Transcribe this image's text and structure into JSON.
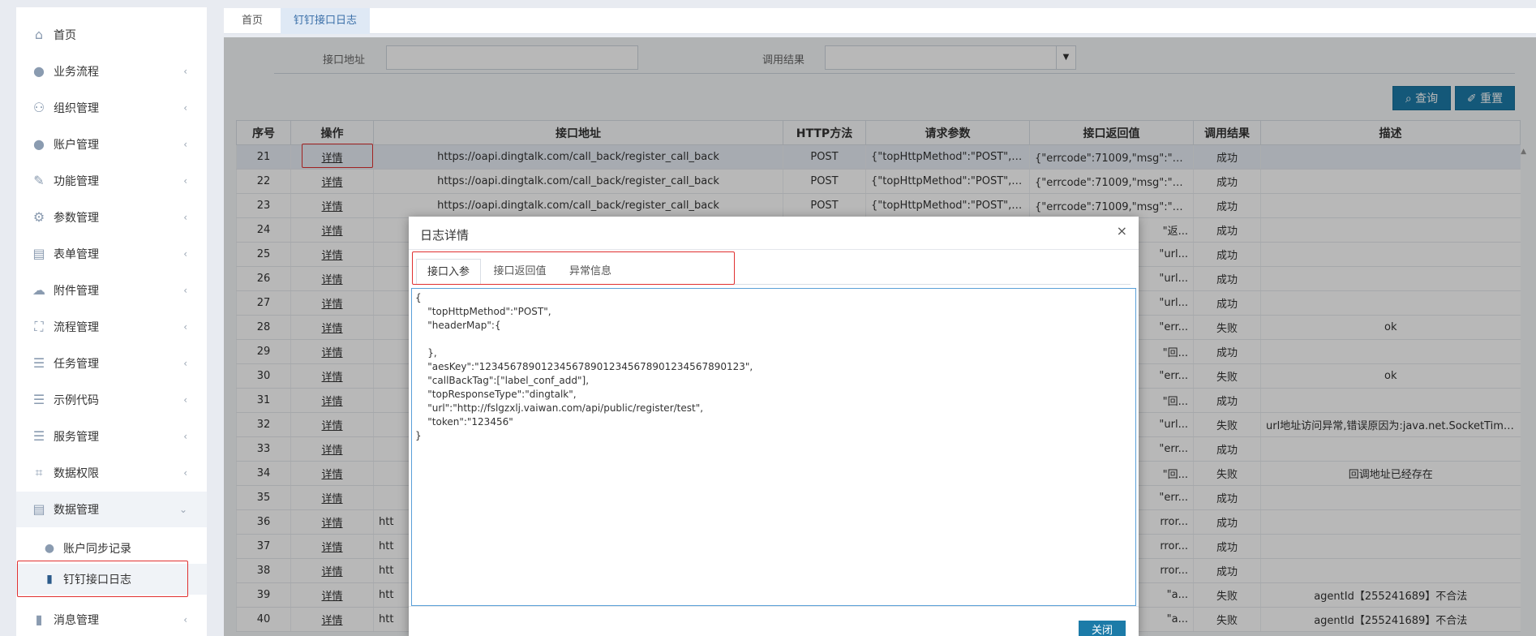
{
  "sidebar": {
    "items": [
      {
        "label": "首页",
        "icon": "home-icon",
        "glyph": "⌂",
        "chevron": ""
      },
      {
        "label": "业务流程",
        "icon": "user-icon",
        "glyph": "●",
        "chevron": "‹"
      },
      {
        "label": "组织管理",
        "icon": "users-group-icon",
        "glyph": "⚇",
        "chevron": "‹"
      },
      {
        "label": "账户管理",
        "icon": "user-icon",
        "glyph": "●",
        "chevron": "‹"
      },
      {
        "label": "功能管理",
        "icon": "wrench-icon",
        "glyph": "✎",
        "chevron": "‹"
      },
      {
        "label": "参数管理",
        "icon": "gears-icon",
        "glyph": "⚙",
        "chevron": "‹"
      },
      {
        "label": "表单管理",
        "icon": "form-icon",
        "glyph": "▤",
        "chevron": "‹"
      },
      {
        "label": "附件管理",
        "icon": "cloud-upload-icon",
        "glyph": "☁",
        "chevron": "‹"
      },
      {
        "label": "流程管理",
        "icon": "sitemap-icon",
        "glyph": "⛶",
        "chevron": "‹"
      },
      {
        "label": "任务管理",
        "icon": "tasks-icon",
        "glyph": "☰",
        "chevron": "‹"
      },
      {
        "label": "示例代码",
        "icon": "server-icon",
        "glyph": "☰",
        "chevron": "‹"
      },
      {
        "label": "服务管理",
        "icon": "server-icon",
        "glyph": "☰",
        "chevron": "‹"
      },
      {
        "label": "数据权限",
        "icon": "crop-icon",
        "glyph": "⌗",
        "chevron": "‹"
      },
      {
        "label": "数据管理",
        "icon": "database-icon",
        "glyph": "▤",
        "chevron": "⌄"
      }
    ],
    "sub_items": [
      {
        "label": "账户同步记录",
        "icon": "user-icon",
        "glyph": "●"
      },
      {
        "label": "钉钉接口日志",
        "icon": "book-icon",
        "glyph": "▮"
      }
    ],
    "last_item": {
      "label": "消息管理",
      "icon": "book-icon",
      "glyph": "▮",
      "chevron": "‹"
    }
  },
  "tabs": [
    {
      "label": "首页"
    },
    {
      "label": "钉钉接口日志"
    }
  ],
  "search": {
    "address_label": "接口地址",
    "address_value": "",
    "result_label": "调用结果",
    "result_value": "",
    "dropdown_arrow": "▼",
    "query_label": "查询",
    "query_icon": "search-icon",
    "reset_label": "重置",
    "reset_icon": "eraser-icon"
  },
  "table": {
    "columns": [
      "序号",
      "操作",
      "接口地址",
      "HTTP方法",
      "请求参数",
      "接口返回值",
      "调用结果",
      "描述"
    ],
    "rows": [
      {
        "no": "21",
        "op": "详情",
        "url": "https://oapi.dingtalk.com/call_back/register_call_back",
        "method": "POST",
        "params": "{\"topHttpMethod\":\"POST\",\"h...",
        "ret": "{\"errcode\":71009,\"msg\":\"返...",
        "result": "成功",
        "desc": ""
      },
      {
        "no": "22",
        "op": "详情",
        "url": "https://oapi.dingtalk.com/call_back/register_call_back",
        "method": "POST",
        "params": "{\"topHttpMethod\":\"POST\",\"h...",
        "ret": "{\"errcode\":71009,\"msg\":\"返...",
        "result": "成功",
        "desc": ""
      },
      {
        "no": "23",
        "op": "详情",
        "url": "https://oapi.dingtalk.com/call_back/register_call_back",
        "method": "POST",
        "params": "{\"topHttpMethod\":\"POST\",\"h...",
        "ret": "{\"errcode\":71009,\"msg\":\"返...",
        "result": "成功",
        "desc": ""
      },
      {
        "no": "24",
        "op": "详情",
        "url": "",
        "method": "",
        "params": "",
        "ret": "\"返...",
        "result": "成功",
        "desc": ""
      },
      {
        "no": "25",
        "op": "详情",
        "url": "",
        "method": "",
        "params": "",
        "ret": "\"url...",
        "result": "成功",
        "desc": ""
      },
      {
        "no": "26",
        "op": "详情",
        "url": "",
        "method": "",
        "params": "",
        "ret": "\"url...",
        "result": "成功",
        "desc": ""
      },
      {
        "no": "27",
        "op": "详情",
        "url": "",
        "method": "",
        "params": "",
        "ret": "\"url...",
        "result": "成功",
        "desc": ""
      },
      {
        "no": "28",
        "op": "详情",
        "url": "",
        "method": "",
        "params": "",
        "ret": "\"err...",
        "result": "失败",
        "desc": "ok"
      },
      {
        "no": "29",
        "op": "详情",
        "url": "",
        "method": "",
        "params": "",
        "ret": "\"回...",
        "result": "成功",
        "desc": ""
      },
      {
        "no": "30",
        "op": "详情",
        "url": "",
        "method": "",
        "params": "",
        "ret": "\"err...",
        "result": "失败",
        "desc": "ok"
      },
      {
        "no": "31",
        "op": "详情",
        "url": "",
        "method": "",
        "params": "",
        "ret": "\"回...",
        "result": "成功",
        "desc": ""
      },
      {
        "no": "32",
        "op": "详情",
        "url": "",
        "method": "",
        "params": "",
        "ret": "\"url...",
        "result": "失败",
        "desc": "url地址访问异常,错误原因为:java.net.SocketTimeoutE..."
      },
      {
        "no": "33",
        "op": "详情",
        "url": "",
        "method": "",
        "params": "",
        "ret": "\"err...",
        "result": "成功",
        "desc": ""
      },
      {
        "no": "34",
        "op": "详情",
        "url": "",
        "method": "",
        "params": "",
        "ret": "\"回...",
        "result": "失败",
        "desc": "回调地址已经存在"
      },
      {
        "no": "35",
        "op": "详情",
        "url": "",
        "method": "",
        "params": "",
        "ret": "\"err...",
        "result": "成功",
        "desc": ""
      },
      {
        "no": "36",
        "op": "详情",
        "url": "htt",
        "method": "",
        "params": "",
        "ret": "rror...",
        "result": "成功",
        "desc": ""
      },
      {
        "no": "37",
        "op": "详情",
        "url": "htt",
        "method": "",
        "params": "",
        "ret": "rror...",
        "result": "成功",
        "desc": ""
      },
      {
        "no": "38",
        "op": "详情",
        "url": "htt",
        "method": "",
        "params": "",
        "ret": "rror...",
        "result": "成功",
        "desc": ""
      },
      {
        "no": "39",
        "op": "详情",
        "url": "htt",
        "method": "",
        "params": "",
        "ret": "\"a...",
        "result": "失败",
        "desc": "agentId【255241689】不合法"
      },
      {
        "no": "40",
        "op": "详情",
        "url": "htt",
        "method": "",
        "params": "",
        "ret": "\"a...",
        "result": "失败",
        "desc": "agentId【255241689】不合法"
      }
    ]
  },
  "modal": {
    "title": "日志详情",
    "close_glyph": "×",
    "tabs": [
      {
        "label": "接口入参"
      },
      {
        "label": "接口返回值"
      },
      {
        "label": "异常信息"
      }
    ],
    "content": "{\n    \"topHttpMethod\":\"POST\",\n    \"headerMap\":{\n\n    },\n    \"aesKey\":\"1234567890123456789012345678901234567890123\",\n    \"callBackTag\":[\"label_conf_add\"],\n    \"topResponseType\":\"dingtalk\",\n    \"url\":\"http://fslgzxlj.vaiwan.com/api/public/register/test\",\n    \"token\":\"123456\"\n}",
    "close_label": "关闭"
  },
  "colors": {
    "accent": "#1c7ba8",
    "success": "#3c9a3c",
    "fail": "#d94040",
    "highlight": "#e03030"
  }
}
